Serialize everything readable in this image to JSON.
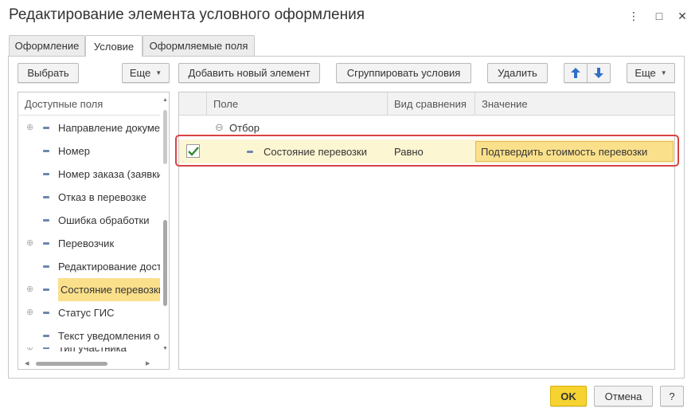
{
  "window": {
    "title": "Редактирование элемента условного оформления",
    "menu_icon": "⋮",
    "maximize_icon": "□",
    "close_icon": "✕"
  },
  "tabs": [
    {
      "label": "Оформление",
      "active": false
    },
    {
      "label": "Условие",
      "active": true
    },
    {
      "label": "Оформляемые поля",
      "active": false
    }
  ],
  "left_toolbar": {
    "select_label": "Выбрать",
    "more_label": "Еще"
  },
  "right_toolbar": {
    "add_label": "Добавить новый элемент",
    "group_label": "Сгруппировать условия",
    "delete_label": "Удалить",
    "up_icon": "arrow-up-icon",
    "down_icon": "arrow-down-icon",
    "more_label": "Еще"
  },
  "available_fields": {
    "header": "Доступные поля",
    "items": [
      {
        "label": "Направление документа",
        "expandable": true,
        "selected": false
      },
      {
        "label": "Номер",
        "expandable": false,
        "selected": false
      },
      {
        "label": "Номер заказа (заявки)",
        "expandable": false,
        "selected": false
      },
      {
        "label": "Отказ в перевозке",
        "expandable": false,
        "selected": false
      },
      {
        "label": "Ошибка обработки",
        "expandable": false,
        "selected": false
      },
      {
        "label": "Перевозчик",
        "expandable": true,
        "selected": false
      },
      {
        "label": "Редактирование доступно",
        "expandable": false,
        "selected": false
      },
      {
        "label": "Состояние перевозки",
        "expandable": true,
        "selected": true
      },
      {
        "label": "Статус ГИС",
        "expandable": true,
        "selected": false
      },
      {
        "label": "Текст уведомления о",
        "expandable": false,
        "selected": false
      },
      {
        "label": "Тип участника",
        "expandable": true,
        "selected": false
      }
    ],
    "vscroll_position": 0.72,
    "hscroll_position": 0.0
  },
  "conditions_table": {
    "columns": {
      "field": "Поле",
      "comparison": "Вид сравнения",
      "value": "Значение"
    },
    "group": {
      "label": "Отбор",
      "toggle_icon": "⊖"
    },
    "rows": [
      {
        "checked": true,
        "field": "Состояние перевозки",
        "comparison": "Равно",
        "value": "Подтвердить стоимость перевозки"
      }
    ]
  },
  "footer": {
    "ok_label": "OK",
    "cancel_label": "Отмена",
    "help_label": "?"
  },
  "colors": {
    "selection": "#fbe08c",
    "row_highlight": "#fdf6d3",
    "annotation_frame": "#d94343",
    "ok_button": "#f6d330",
    "checkmark": "#2f8a2f",
    "arrow_blue": "#2f6fc8"
  }
}
